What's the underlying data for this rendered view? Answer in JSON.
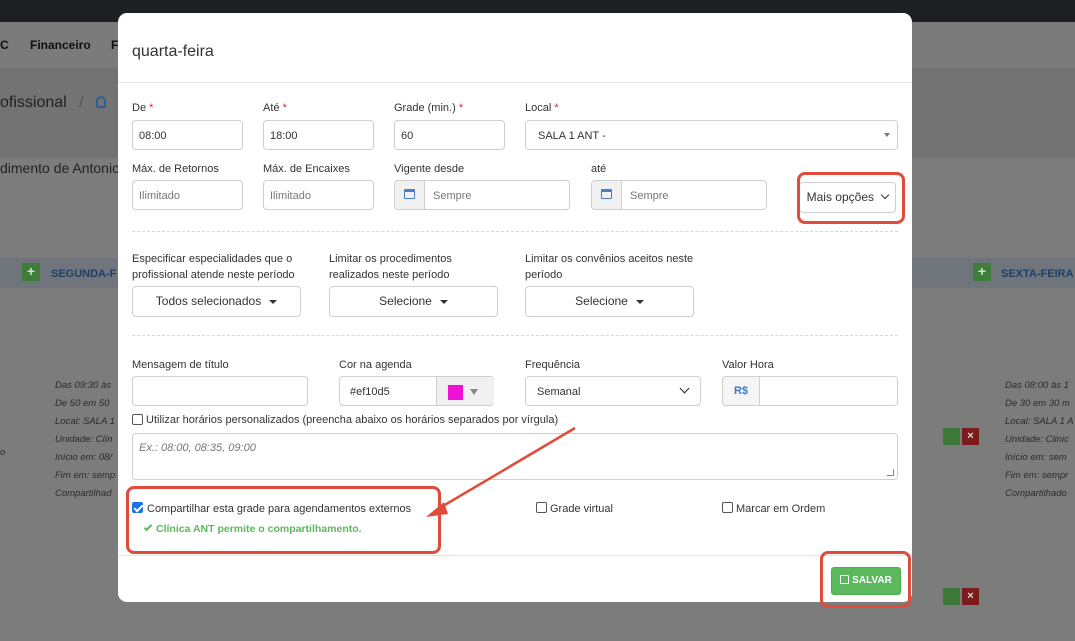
{
  "background": {
    "nav_items": [
      "C",
      "Financeiro",
      "F"
    ],
    "page_title": "ofissional",
    "page_sep": "/",
    "subtitle": "dimento de Antonic",
    "day_left": "SEGUNDA-F",
    "day_right": "SEXTA-FEIRA",
    "info_left": [
      "Das 09:30 às",
      "De 50 em 50",
      "Local: SALA 1",
      "Unidade: Clín",
      "Início em: 08/",
      "Fim em: semp",
      "Compartilhad"
    ],
    "info_right": [
      "Das 08:00 às 1",
      "De 30 em 30 m",
      "Local: SALA 1 A",
      "Unidade: Clinic",
      "Início em: sem",
      "Fim em: sempr",
      "Compartilhado"
    ],
    "edge_char": "o"
  },
  "modal": {
    "title": "quarta-feira",
    "fields": {
      "de": {
        "label": "De",
        "value": "08:00"
      },
      "ate": {
        "label": "Até",
        "value": "18:00"
      },
      "grade": {
        "label": "Grade (min.)",
        "value": "60"
      },
      "local": {
        "label": "Local",
        "value": "SALA 1 ANT -"
      },
      "max_retornos": {
        "label": "Máx. de Retornos",
        "placeholder": "Ilimitado"
      },
      "max_encaixes": {
        "label": "Máx. de Encaixes",
        "placeholder": "Ilimitado"
      },
      "vigente_desde": {
        "label": "Vigente desde",
        "placeholder": "Sempre"
      },
      "vigente_ate": {
        "label": "até",
        "placeholder": "Sempre"
      },
      "required_mark": "*"
    },
    "mais_opcoes": "Mais opções",
    "especialidades": {
      "label": "Especificar especialidades que o profissional atende neste período",
      "value": "Todos selecionados"
    },
    "procedimentos": {
      "label": "Limitar os procedimentos realizados neste período",
      "value": "Selecione"
    },
    "convenios": {
      "label": "Limitar os convênios aceitos neste período",
      "value": "Selecione"
    },
    "mensagem_titulo": {
      "label": "Mensagem de título",
      "value": ""
    },
    "cor_agenda": {
      "label": "Cor na agenda",
      "value": "#ef10d5"
    },
    "frequencia": {
      "label": "Frequência",
      "value": "Semanal"
    },
    "valor_hora": {
      "label": "Valor Hora",
      "prefix": "R$",
      "value": ""
    },
    "horarios_personalizados": {
      "label": "Utilizar horários personalizados (preencha abaixo os horários separados por vírgula)",
      "checked": false,
      "placeholder": "Ex.: 08:00, 08:35, 09:00"
    },
    "compartilhar": {
      "label": "Compartilhar esta grade para agendamentos externos",
      "checked": true,
      "status": "Clínica ANT permite o compartilhamento."
    },
    "grade_virtual": {
      "label": "Grade virtual",
      "checked": false
    },
    "marcar_ordem": {
      "label": "Marcar em Ordem",
      "checked": false
    },
    "save_label": "SALVAR"
  },
  "colors": {
    "accent_annotation": "#e04b3a",
    "save_green": "#5cb85c",
    "agenda_color": "#ef10d5",
    "required_red": "#d9261c"
  }
}
